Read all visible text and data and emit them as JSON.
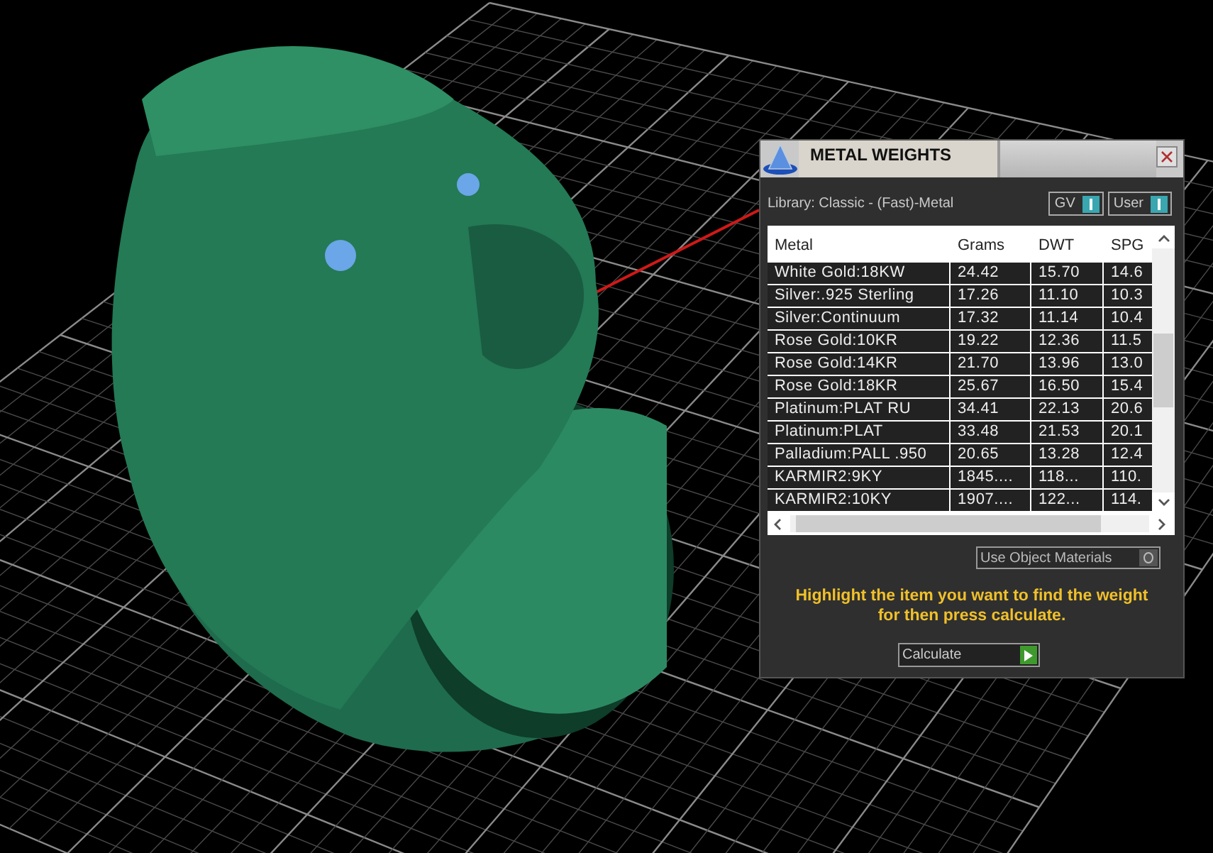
{
  "window": {
    "title": "METAL WEIGHTS"
  },
  "library": {
    "label": "Library: Classic - (Fast)-Metal"
  },
  "toggles": [
    {
      "label": "GV",
      "on": true
    },
    {
      "label": "User",
      "on": true
    }
  ],
  "table": {
    "columns": [
      "Metal",
      "Grams",
      "DWT",
      "SPG"
    ],
    "rows": [
      [
        "White Gold:18KW",
        "24.42",
        "15.70",
        "14.6"
      ],
      [
        "Silver:.925 Sterling",
        "17.26",
        "11.10",
        "10.3"
      ],
      [
        "Silver:Continuum",
        "17.32",
        "11.14",
        "10.4"
      ],
      [
        "Rose Gold:10KR",
        "19.22",
        "12.36",
        "11.5"
      ],
      [
        "Rose Gold:14KR",
        "21.70",
        "13.96",
        "13.0"
      ],
      [
        "Rose Gold:18KR",
        "25.67",
        "16.50",
        "15.4"
      ],
      [
        "Platinum:PLAT RU",
        "34.41",
        "22.13",
        "20.6"
      ],
      [
        "Platinum:PLAT",
        "33.48",
        "21.53",
        "20.1"
      ],
      [
        "Palladium:PALL .950",
        "20.65",
        "13.28",
        "12.4"
      ],
      [
        "KARMIR2:9KY",
        "1845....",
        "118...",
        "110."
      ],
      [
        "KARMIR2:10KY",
        "1907....",
        "122...",
        "114."
      ]
    ]
  },
  "object_materials": {
    "label": "Use Object Materials",
    "on": false
  },
  "hint": "Highlight the item you want to find the weight for then press calculate.",
  "calculate_button": {
    "label": "Calculate"
  }
}
